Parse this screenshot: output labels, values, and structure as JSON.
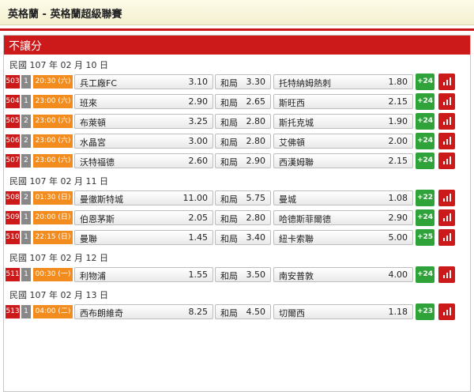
{
  "header": {
    "title": "英格蘭 - 英格蘭超級聯賽"
  },
  "panel": {
    "title": "不讓分",
    "draw_label": "和局"
  },
  "days": [
    {
      "date": "民國 107 年 02 月 10 日",
      "matches": [
        {
          "no": "503",
          "league": "1",
          "time": "20:30 (六)",
          "home": "兵工廠FC",
          "home_odds": "3.10",
          "draw_odds": "3.30",
          "away": "托特納姆熱刺",
          "away_odds": "1.80",
          "more": "+24"
        },
        {
          "no": "504",
          "league": "1",
          "time": "23:00 (六)",
          "home": "班來",
          "home_odds": "2.90",
          "draw_odds": "2.65",
          "away": "斯旺西",
          "away_odds": "2.15",
          "more": "+24"
        },
        {
          "no": "505",
          "league": "2",
          "time": "23:00 (六)",
          "home": "布萊頓",
          "home_odds": "3.25",
          "draw_odds": "2.80",
          "away": "斯托克城",
          "away_odds": "1.90",
          "more": "+24"
        },
        {
          "no": "506",
          "league": "2",
          "time": "23:00 (六)",
          "home": "水晶宮",
          "home_odds": "3.00",
          "draw_odds": "2.80",
          "away": "艾佛頓",
          "away_odds": "2.00",
          "more": "+24"
        },
        {
          "no": "507",
          "league": "2",
          "time": "23:00 (六)",
          "home": "沃特福德",
          "home_odds": "2.60",
          "draw_odds": "2.90",
          "away": "西漢姆聯",
          "away_odds": "2.15",
          "more": "+24"
        }
      ]
    },
    {
      "date": "民國 107 年 02 月 11 日",
      "matches": [
        {
          "no": "508",
          "league": "2",
          "time": "01:30 (日)",
          "home": "曼徹斯特城",
          "home_odds": "11.00",
          "draw_odds": "5.75",
          "away": "曼城",
          "away_odds": "1.08",
          "more": "+22"
        },
        {
          "no": "509",
          "league": "1",
          "time": "20:00 (日)",
          "home": "伯恩茅斯",
          "home_odds": "2.05",
          "draw_odds": "2.80",
          "away": "哈德斯菲爾德",
          "away_odds": "2.90",
          "more": "+24"
        },
        {
          "no": "510",
          "league": "1",
          "time": "22:15 (日)",
          "home": "曼聯",
          "home_odds": "1.45",
          "draw_odds": "3.40",
          "away": "紐卡索聯",
          "away_odds": "5.00",
          "more": "+25"
        }
      ]
    },
    {
      "date": "民國 107 年 02 月 12 日",
      "matches": [
        {
          "no": "511",
          "league": "1",
          "time": "00:30 (一)",
          "home": "利物浦",
          "home_odds": "1.55",
          "draw_odds": "3.50",
          "away": "南安普敦",
          "away_odds": "4.00",
          "more": "+24"
        }
      ]
    },
    {
      "date": "民國 107 年 02 月 13 日",
      "matches": [
        {
          "no": "513",
          "league": "1",
          "time": "04:00 (二)",
          "home": "西布朗維奇",
          "home_odds": "8.25",
          "draw_odds": "4.50",
          "away": "切爾西",
          "away_odds": "1.18",
          "more": "+23"
        }
      ]
    }
  ],
  "colors": {
    "accent_red": "#cc1a1a",
    "more_green": "#2fa33a",
    "time_orange": "#f28c1e"
  },
  "icons": {
    "stats": "bar-chart-icon"
  }
}
